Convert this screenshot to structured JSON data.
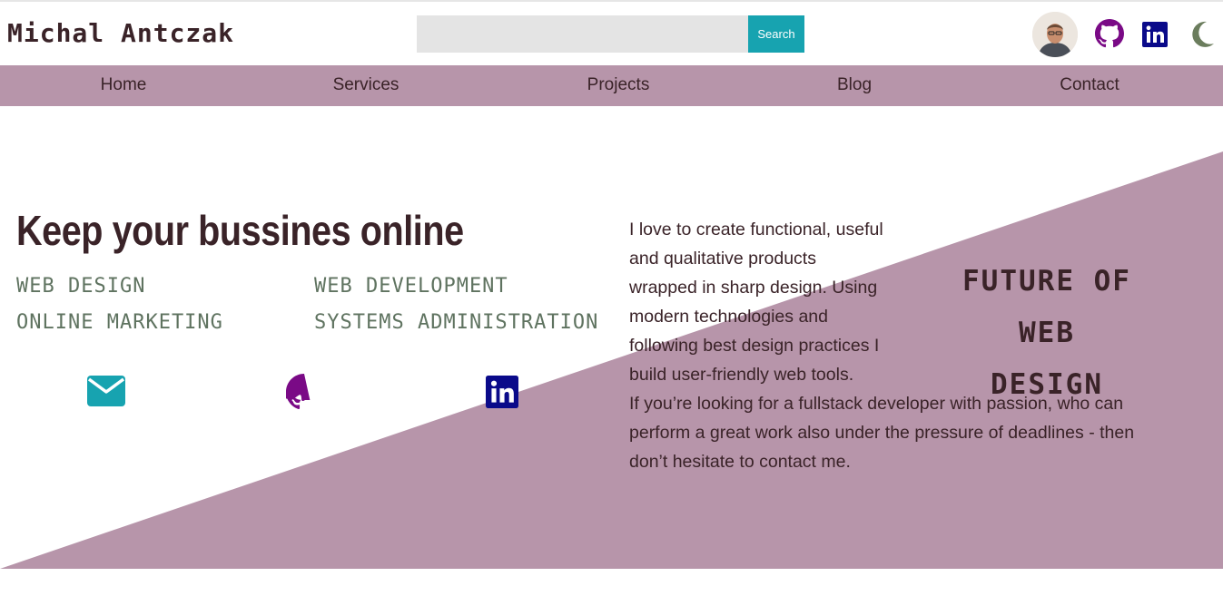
{
  "header": {
    "brand": "Michal Antczak",
    "search": {
      "placeholder": "",
      "value": "",
      "button_label": "Search"
    },
    "icons": [
      "avatar",
      "github-icon",
      "linkedin-icon",
      "moon-icon"
    ]
  },
  "nav": {
    "items": [
      {
        "label": "Home"
      },
      {
        "label": "Services"
      },
      {
        "label": "Projects"
      },
      {
        "label": "Blog"
      },
      {
        "label": "Contact"
      }
    ]
  },
  "hero": {
    "headline": "Keep your bussines online",
    "services": [
      "WEB DESIGN",
      "WEB DEVELOPMENT",
      "ONLINE MARKETING",
      "SYSTEMS ADMINISTRATION"
    ],
    "social_icons": [
      "mail-icon",
      "github-icon",
      "linkedin-icon"
    ],
    "about_1": "I love to create functional, useful and qualitative products wrapped in sharp design. Using modern technologies and following best design practices I build user-friendly web tools.",
    "about_2": "If you’re looking for a fullstack developer with passion, who can perform a great work also under the pressure of deadlines - then don’t hesitate to contact me.",
    "tagline_line1": "FUTURE OF",
    "tagline_line2": "WEB DESIGN"
  },
  "colors": {
    "accent_mauve": "#b795aa",
    "teal": "#17a3b0",
    "github_purple": "#7a0a86",
    "linkedin_navy": "#0a0a8a",
    "moon_green": "#6b7d5d",
    "text_dark": "#3a2328",
    "service_green": "#5f7360"
  }
}
